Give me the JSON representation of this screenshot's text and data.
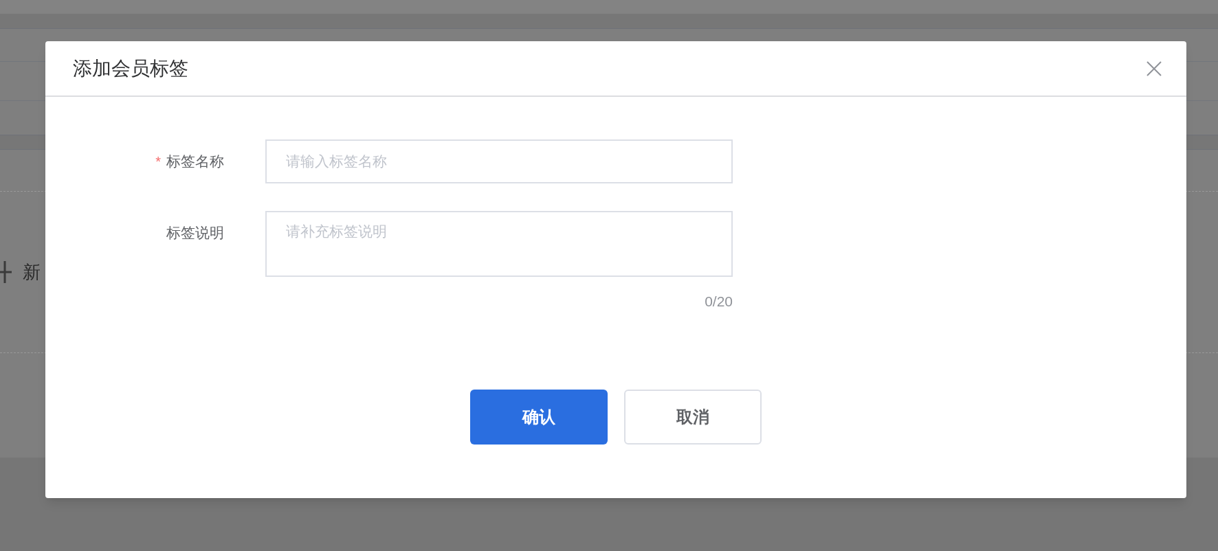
{
  "background": {
    "add_button": {
      "label": "新"
    }
  },
  "dialog": {
    "title": "添加会员标签",
    "fields": [
      {
        "kind": "input",
        "label": "标签名称",
        "required_mark": "*",
        "placeholder": "请输入标签名称"
      },
      {
        "kind": "textarea",
        "label": "标签说明",
        "placeholder": "请补充标签说明",
        "counter": "0/20"
      }
    ],
    "buttons": [
      {
        "label": "确认",
        "primary": true
      },
      {
        "label": "取消",
        "primary": false
      }
    ]
  }
}
